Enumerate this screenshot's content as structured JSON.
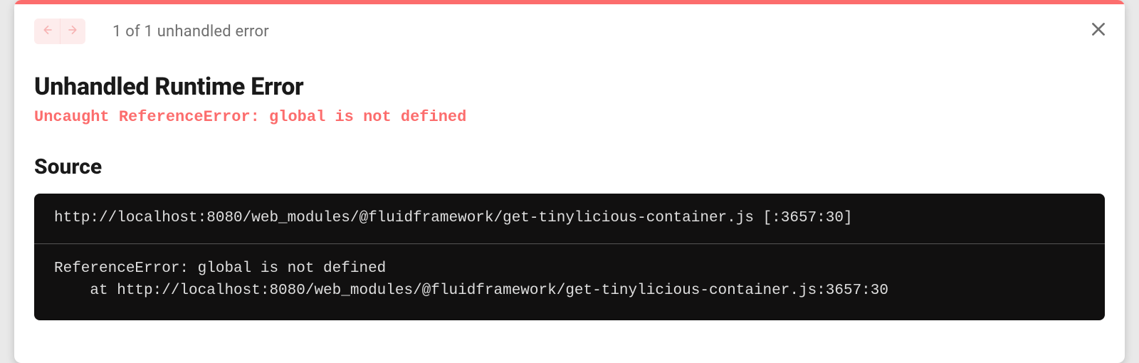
{
  "counter_text": "1 of 1 unhandled error",
  "title": "Unhandled Runtime Error",
  "error_message": "Uncaught ReferenceError: global is not defined",
  "source_heading": "Source",
  "source_location": "http://localhost:8080/web_modules/@fluidframework/get-tinylicious-container.js [:3657:30]",
  "stack_trace": "ReferenceError: global is not defined\n    at http://localhost:8080/web_modules/@fluidframework/get-tinylicious-container.js:3657:30",
  "colors": {
    "accent_red": "#fc6d6d",
    "code_bg": "#111010"
  }
}
